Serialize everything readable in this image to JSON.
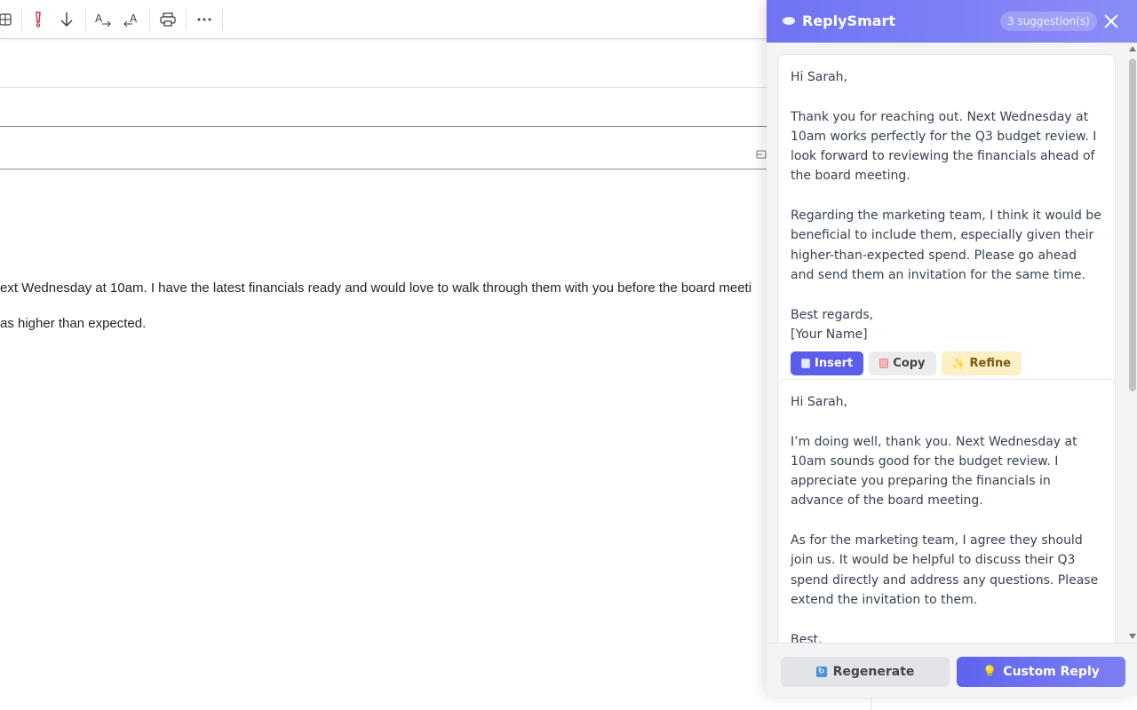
{
  "email": {
    "body_line_1": "ext Wednesday at 10am. I have the latest financials ready and would love to walk through them with you before the board meeti",
    "body_line_2": "as higher than expected."
  },
  "panel": {
    "brand": "ReplySmart",
    "suggestion_count": "3 suggestion(s)",
    "suggestions": [
      {
        "paragraphs": [
          "Hi Sarah,",
          "Thank you for reaching out. Next Wednesday at 10am works perfectly for the Q3 budget review. I look forward to reviewing the financials ahead of the board meeting.",
          "Regarding the marketing team, I think it would be beneficial to include them, especially given their higher-than-expected spend. Please go ahead and send them an invitation for the same time.",
          "Best regards,\n[Your Name]"
        ],
        "actions": {
          "insert": "Insert",
          "copy": "Copy",
          "refine": "Refine"
        }
      },
      {
        "paragraphs": [
          "Hi Sarah,",
          "I’m doing well, thank you. Next Wednesday at 10am sounds good for the budget review. I appreciate you preparing the financials in advance of the board meeting.",
          "As for the marketing team, I agree they should join us. It would be helpful to discuss their Q3 spend directly and address any questions. Please extend the invitation to them.",
          "Best,"
        ]
      }
    ],
    "footer": {
      "regenerate": "Regenerate",
      "custom_reply": "Custom Reply"
    }
  },
  "colors": {
    "accent": "#5b5ee8",
    "header_start": "#6f73f3",
    "header_end": "#8a8cf6",
    "refine_bg": "#fcf0c6",
    "flag_red": "#c4314b"
  }
}
